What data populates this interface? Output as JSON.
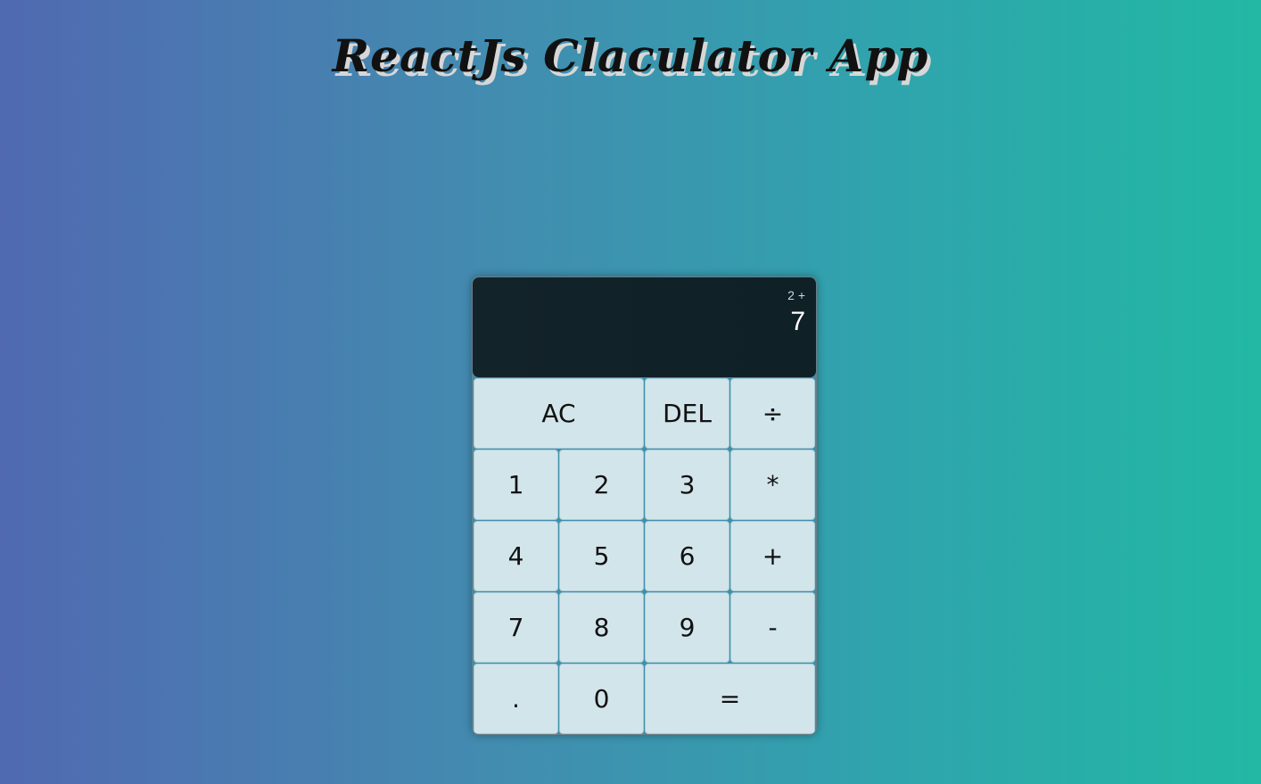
{
  "app": {
    "title": "ReactJs Claculator App"
  },
  "display": {
    "previous": "2 +",
    "current": "7"
  },
  "keys": {
    "ac": "AC",
    "del": "DEL",
    "divide": "÷",
    "one": "1",
    "two": "2",
    "three": "3",
    "multiply": "*",
    "four": "4",
    "five": "5",
    "six": "6",
    "plus": "+",
    "seven": "7",
    "eight": "8",
    "nine": "9",
    "minus": "-",
    "dot": ".",
    "zero": "0",
    "equals": "="
  },
  "colors": {
    "gradient_start": "#5069b1",
    "gradient_end": "#22b8a3",
    "display_bg": "#0f2027",
    "key_bg": "#d2e5eb"
  }
}
